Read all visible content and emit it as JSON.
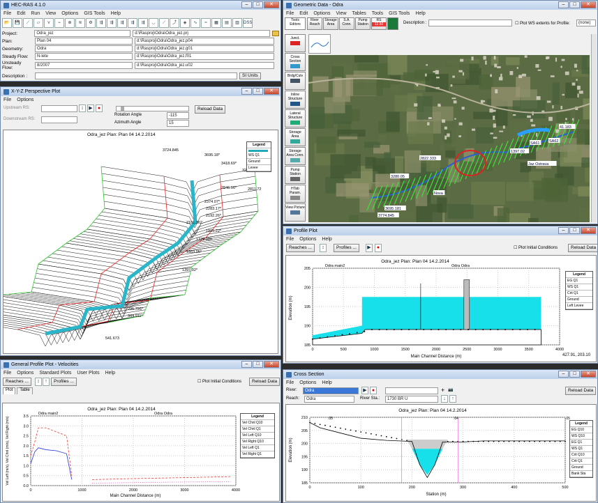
{
  "main": {
    "title": "HEC-RAS 4.1.0",
    "menu": [
      "File",
      "Edit",
      "Run",
      "View",
      "Options",
      "GIS Tools",
      "Help"
    ],
    "fields": [
      {
        "label": "Project:",
        "value": "Odra_jez",
        "path": "d:\\Rasproj\\Odra\\Odra_jez.prj"
      },
      {
        "label": "Plan:",
        "value": "Plan 04",
        "path": "d:\\Rasproj\\Odra\\Odra_jez.p04"
      },
      {
        "label": "Geometry:",
        "value": "Odra",
        "path": "d:\\Rasproj\\Odra\\Odra_jez.g01"
      },
      {
        "label": "Steady Flow:",
        "value": "N-lete",
        "path": "d:\\Rasproj\\Odra\\Odra_jez.f01"
      },
      {
        "label": "Unsteady Flow:",
        "value": "8/2007",
        "path": "d:\\Rasproj\\Odra\\Odra_jez.u02"
      }
    ],
    "desc_label": "Description :",
    "si_units": "SI Units"
  },
  "xyz": {
    "title": "X-Y-Z Perspective Plot",
    "menu": [
      "File",
      "Options"
    ],
    "upstream_label": "Upstream RS:",
    "downstream_label": "Downstream RS:",
    "rot_label": "Rotation Angle",
    "rot_val": "-115",
    "az_label": "Azimuth Angle",
    "az_val": "15",
    "reload": "Reload Data",
    "plot_title": "Odra_jez     Plan: Plan 04    14.2.2014",
    "legend_title": "Legend",
    "legend": [
      "WS Q1",
      "Ground",
      "Levee"
    ],
    "labels": [
      "3724.845",
      "3695.18*",
      "3418.69*",
      "3280.05*",
      "2846.16*",
      "2811.72",
      "2374.07*",
      "2283.17*",
      "2192.26*",
      "2101.362",
      "1915.22*",
      "1729.080",
      "1563.05*",
      "1397.02*",
      "295.726*",
      "344.911*",
      "541.673"
    ]
  },
  "geo": {
    "title": "Geometric Data - Odra",
    "menu": [
      "File",
      "Edit",
      "Options",
      "View",
      "Tables",
      "Tools",
      "GIS Tools",
      "Help"
    ],
    "tools": [
      "River Reach",
      "Storage Area",
      "S.A. Conn.",
      "Pump Station",
      "RS"
    ],
    "rs_box": "12.50",
    "desc_label": "Description :",
    "plot_ws": "Plot WS extents for Profile:",
    "none": "(none)",
    "side": [
      "Junct.",
      "Cross Section",
      "Brdg/Culv",
      "Inline Structure",
      "Lateral Structure",
      "Storage Area",
      "Storage Area Conn.",
      "Pump Station",
      "HTab Param.",
      "View Picture"
    ],
    "map_labels": [
      "41.183",
      "3774.845",
      "3695.181",
      "3280.05",
      "2822.333",
      "1397.02",
      "Jaz Ostrava",
      "SA61",
      "SA62",
      "Nova"
    ]
  },
  "profile": {
    "title": "Profile Plot",
    "menu": [
      "File",
      "Options",
      "Help"
    ],
    "reaches": "Reaches ...",
    "profiles": "Profiles ...",
    "initial": "Plot Initial Conditions",
    "reload": "Reload Data",
    "plot_title": "Odra_jez     Plan: Plan 04    14.2.2014",
    "reach1": "Odra main2",
    "reach2": "Odra Odra",
    "ylabel": "Elevation (m)",
    "xlabel": "Main Channel Distance (m)",
    "yticks": [
      "205",
      "200",
      "195",
      "190",
      "185"
    ],
    "xticks": [
      "0",
      "500",
      "1000",
      "1500",
      "2000",
      "2500",
      "3000",
      "3500",
      "4000"
    ],
    "legend_title": "Legend",
    "legend": [
      "EG Q1",
      "WS Q1",
      "Crit Q1",
      "Ground",
      "Left Levee"
    ],
    "coords": "427.91, 203.10"
  },
  "vel": {
    "title": "General Profile Plot - Velocities",
    "menu": [
      "File",
      "Options",
      "Standard Plots",
      "User Plots",
      "Help"
    ],
    "reaches": "Reaches ...",
    "profiles": "Profiles ...",
    "initial": "Plot Initial Conditions",
    "reload": "Reload Data",
    "tabs": [
      "Plot",
      "Table"
    ],
    "plot_title": "Odra_jez     Plan: Plan 04    14.2.2014",
    "reach1": "Odra main2",
    "reach2": "Odra Odra",
    "ylabel": "Vel Left (m/s), Vel Chnl (m/s), Vel Right (m/s)",
    "xlabel": "Main Channel Distance (m)",
    "yticks": [
      "3.5",
      "3.0",
      "2.5",
      "2.0",
      "1.5",
      "1.0",
      "0.5",
      "0.0"
    ],
    "xticks": [
      "0",
      "1000",
      "2000",
      "3000",
      "4000"
    ],
    "legend_title": "Legend",
    "legend": [
      "Vel Chnl Q10",
      "Vel Chnl Q1",
      "Vel Left Q10",
      "Vel Right Q10",
      "Vel Left Q1",
      "Vel Right Q1"
    ]
  },
  "xs": {
    "title": "Cross Section",
    "menu": [
      "File",
      "Options",
      "Help"
    ],
    "river_label": "River:",
    "river": "Odra",
    "reach_label": "Reach:",
    "reach": "Odra",
    "rs_label": "River Sta.:",
    "rs": "1730  BR U",
    "reload": "Reload Data",
    "plot_title": "Odra_jez     Plan: Plan 04    14.2.2014",
    "ylabel": "Elevation (m)",
    "xlabel": "Station (m)",
    "yticks": [
      "210",
      "205",
      "200",
      "195",
      "190",
      "185"
    ],
    "xticks": [
      "0",
      "100",
      "200",
      "300",
      "400",
      "500"
    ],
    "zones": [
      ".05",
      ".04",
      ".05"
    ],
    "legend_title": "Legend",
    "legend": [
      "EG Q10",
      "WS Q10",
      "EG Q1",
      "WS Q1",
      "Crit Q10",
      "Crit Q1",
      "Ground",
      "Bank Sta"
    ]
  }
}
